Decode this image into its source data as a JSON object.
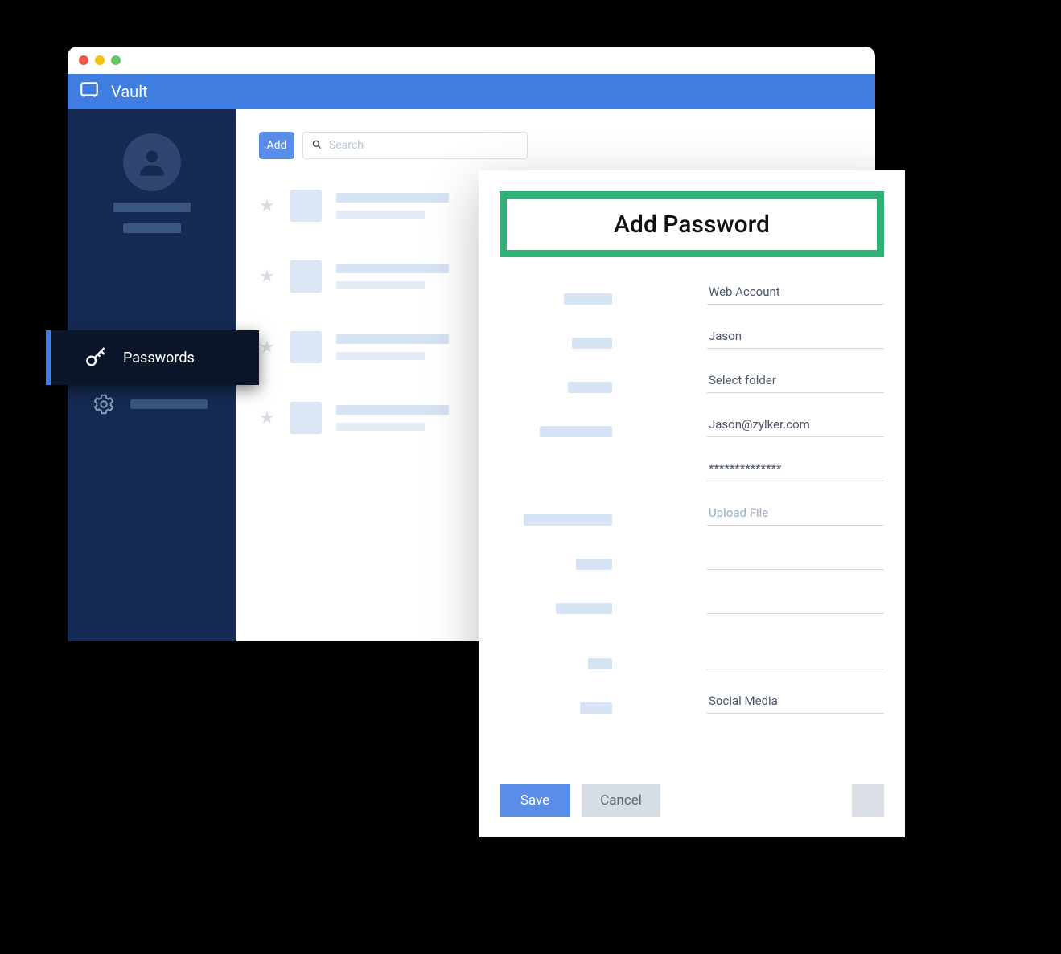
{
  "app": {
    "title": "Vault"
  },
  "sidebar": {
    "active": {
      "label": "Passwords"
    }
  },
  "toolbar": {
    "add_label": "Add",
    "search_placeholder": "Search"
  },
  "dialog": {
    "title": "Add Password",
    "fields": {
      "account_type": "Web Account",
      "name": "Jason",
      "folder": "Select folder",
      "email": "Jason@zylker.com",
      "password": "**************",
      "file": "Upload File",
      "tag": "Social Media"
    },
    "save_label": "Save",
    "cancel_label": "Cancel"
  }
}
